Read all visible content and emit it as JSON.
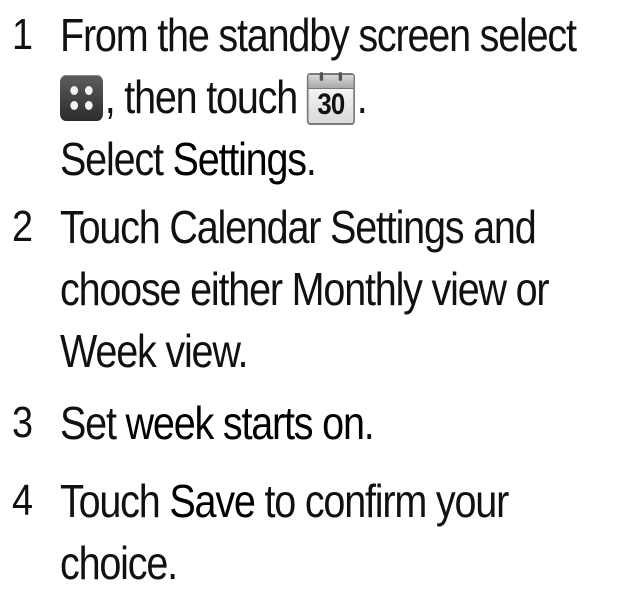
{
  "steps": [
    {
      "number": "1",
      "line1": "From the standby screen select",
      "line2_icon1": "menu-grid-icon",
      "line2_text": ", then touch",
      "line2_icon2": "calendar-icon",
      "calendar_icon_number": "30",
      "line2_end": ".",
      "line3_prefix": "Select ",
      "line3_bold": "Settings",
      "line3_end": "."
    },
    {
      "number": "2",
      "line1": "Touch Calendar Settings and",
      "line2": "choose either Monthly view or",
      "line3": "Week view."
    },
    {
      "number": "3",
      "prefix": "Set ",
      "bold": "week starts on",
      "end": "."
    },
    {
      "number": "4",
      "line1_prefix": "Touch ",
      "line1_bold": "Save",
      "line1_suffix": " to confirm your",
      "line2": "choice."
    }
  ]
}
